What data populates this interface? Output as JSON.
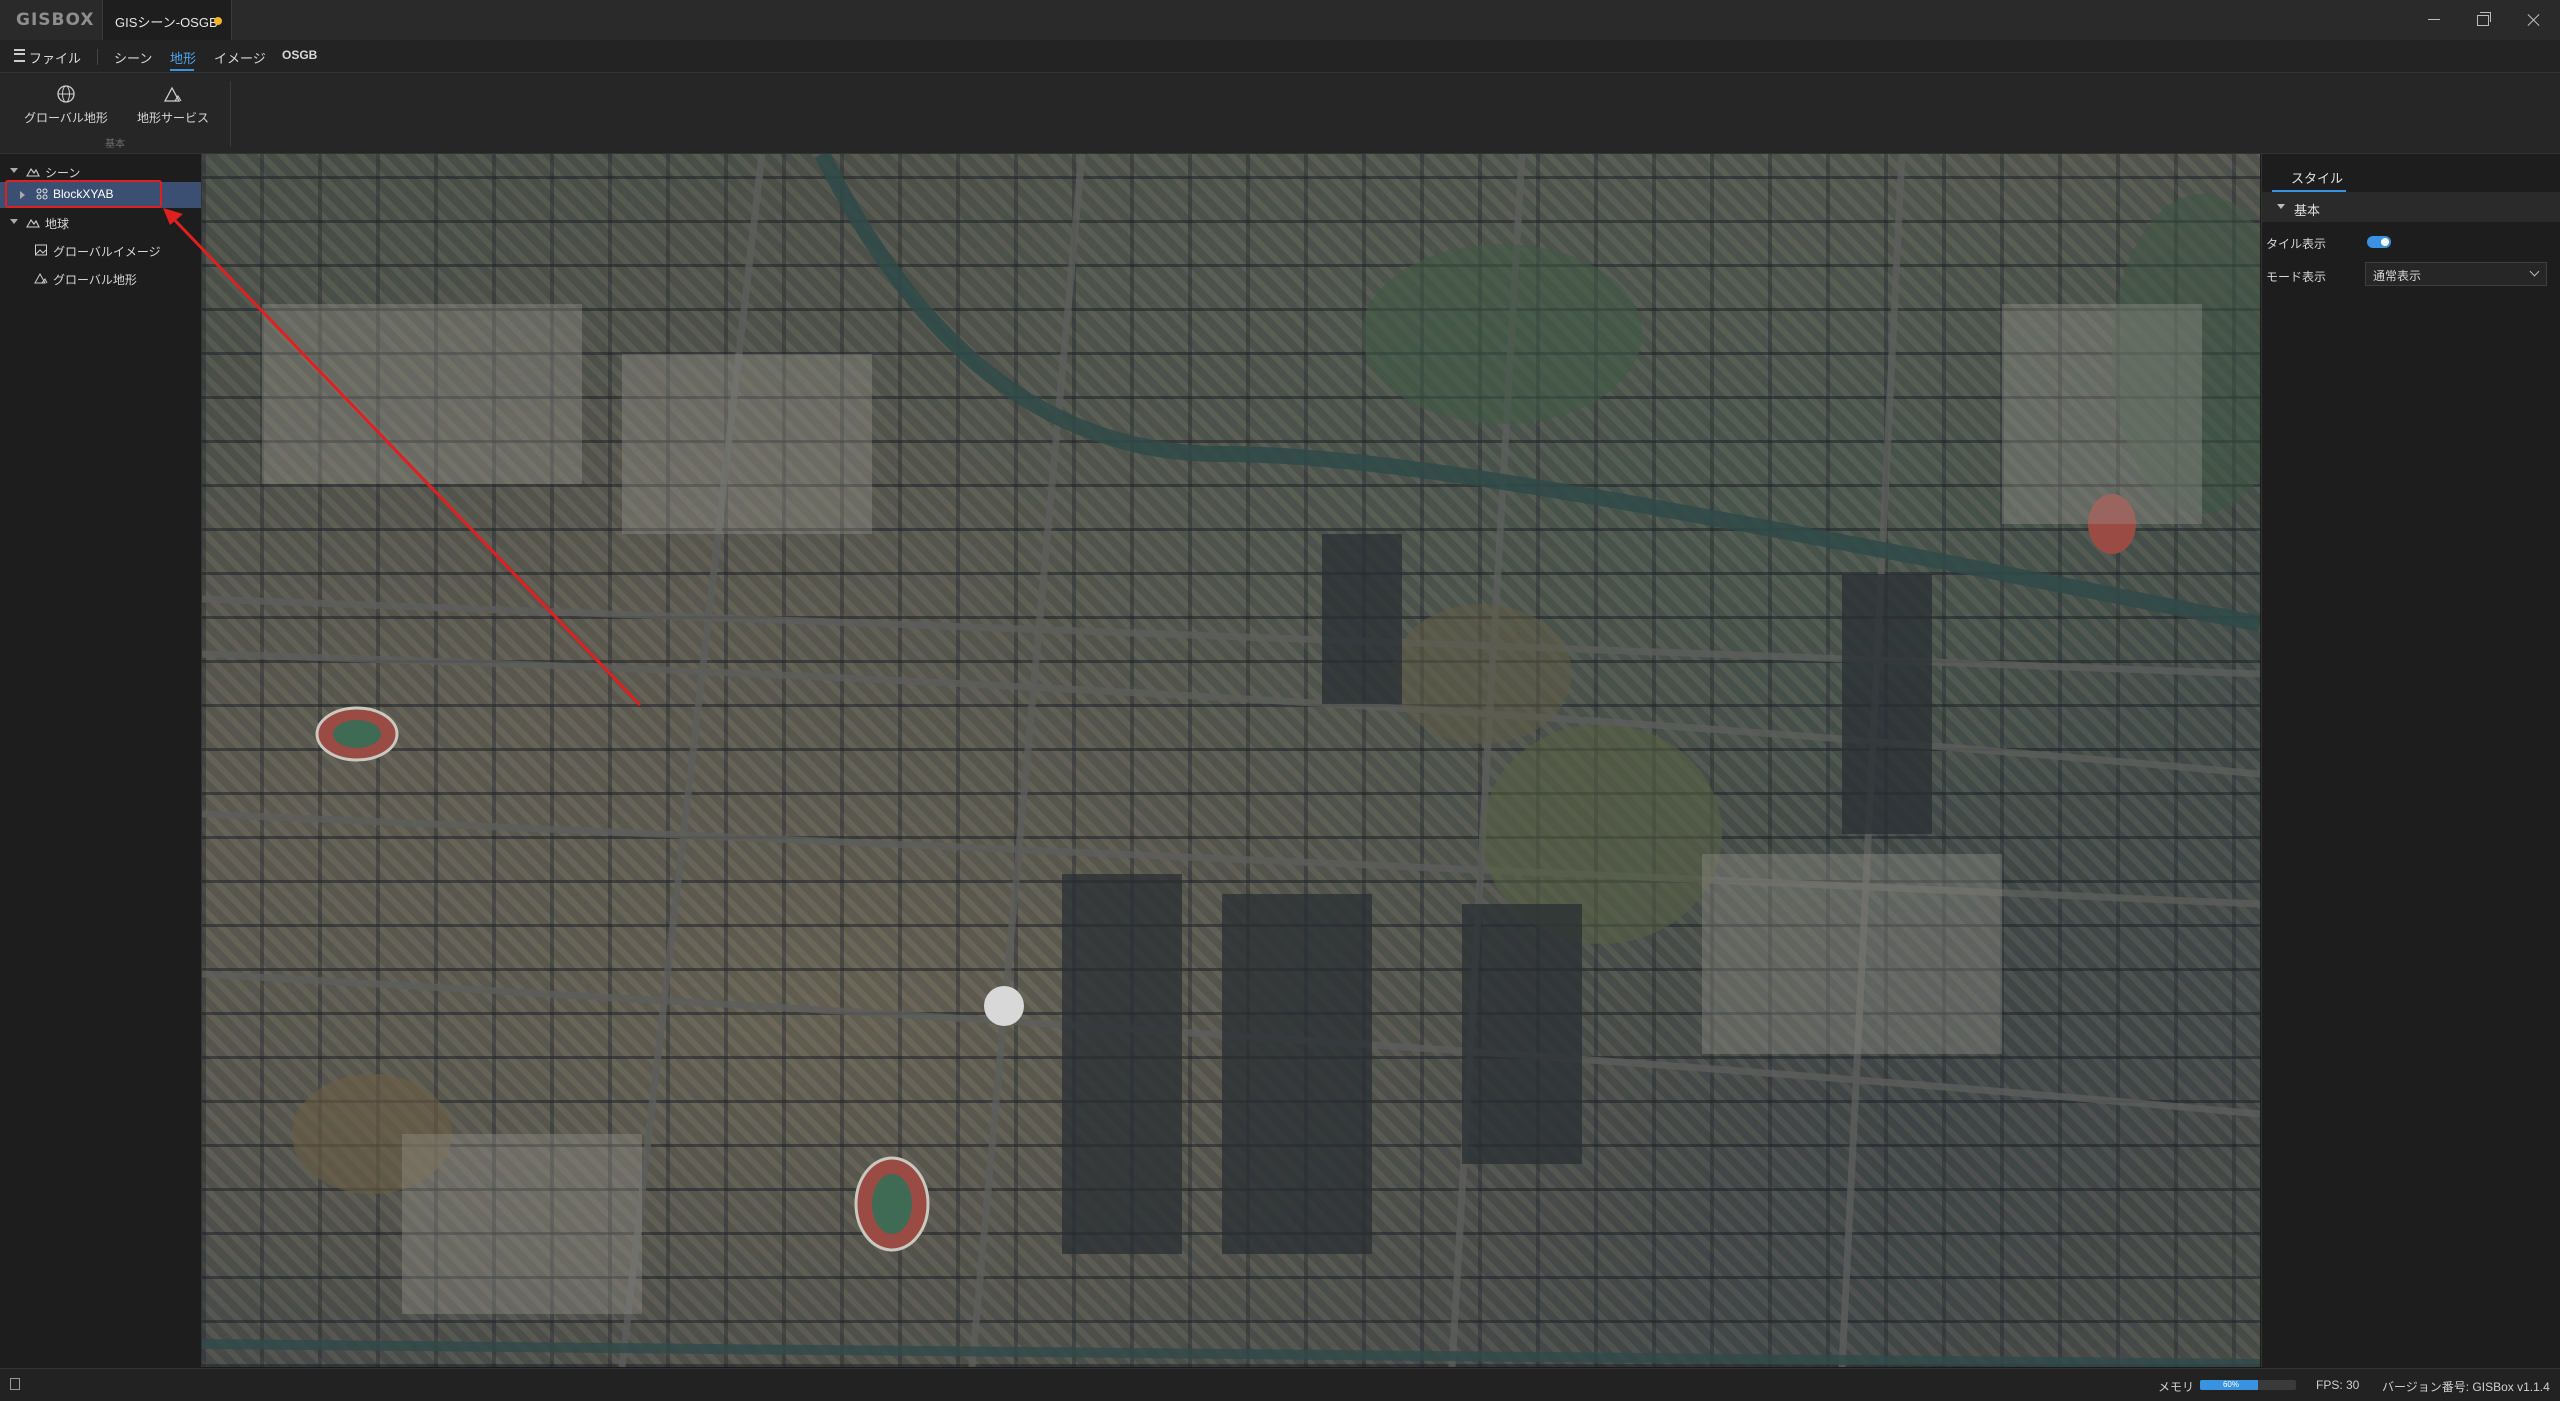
{
  "app": {
    "logo_text": "GISBOX"
  },
  "window": {
    "tab_title": "GISシーン-OSGB",
    "unsaved_indicator_color": "#f0b429"
  },
  "menu": {
    "file": "ファイル",
    "scene": "シーン",
    "terrain": "地形",
    "image": "イメージ",
    "osgb": "OSGB"
  },
  "ribbon": {
    "buttons": [
      {
        "label": "グローバル地形",
        "icon": "globe-icon"
      },
      {
        "label": "地形サービス",
        "icon": "terrain-mountain-icon"
      }
    ],
    "group_label": "基本"
  },
  "tree": {
    "scene": "シーン",
    "blockxyab": "BlockXYAB",
    "earth": "地球",
    "global_image": "グローバルイメージ",
    "global_terrain": "グローバル地形"
  },
  "right_panel": {
    "tab": "スタイル",
    "section": "基本",
    "tile_display_label": "タイル表示",
    "tile_display_on": true,
    "mode_display_label": "モード表示",
    "mode_display_value": "通常表示"
  },
  "status": {
    "memory_label": "メモリ",
    "memory_percent_text": "60%",
    "memory_fraction": 0.6,
    "fps": "FPS: 30",
    "version": "バージョン番号: GISBox v1.1.4"
  },
  "colors": {
    "accent": "#3a93e0",
    "highlight_red": "#e02020",
    "selected_row": "#3b4f72"
  }
}
